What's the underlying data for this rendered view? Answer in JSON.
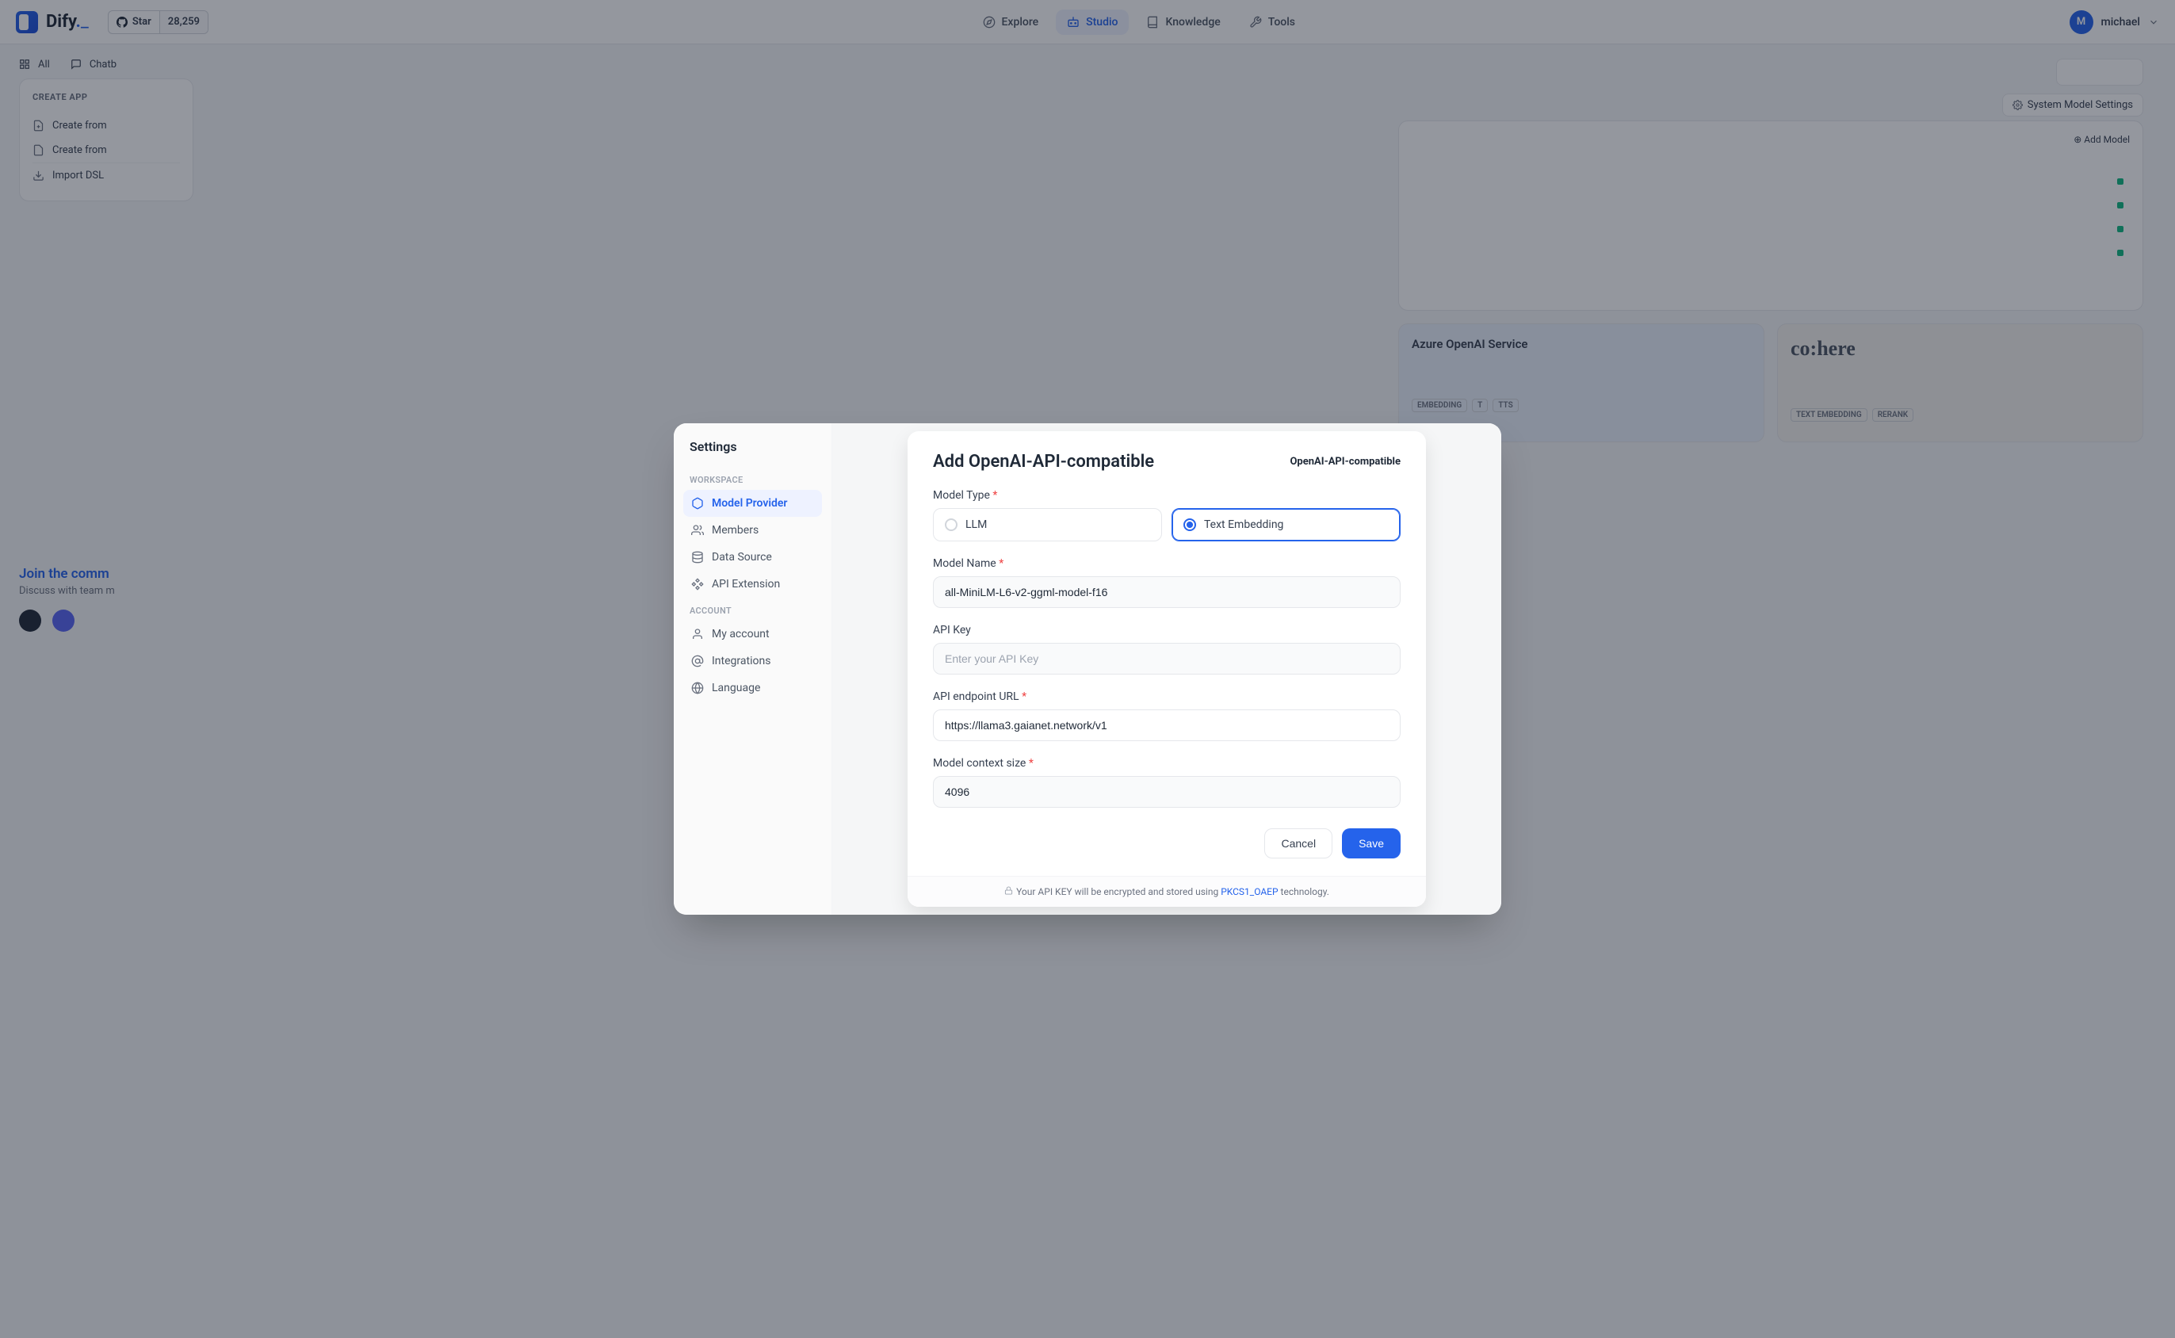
{
  "header": {
    "brand": "Dify",
    "star_label": "Star",
    "star_count": "28,259",
    "nav": {
      "explore": "Explore",
      "studio": "Studio",
      "knowledge": "Knowledge",
      "tools": "Tools"
    },
    "user": {
      "initial": "M",
      "name": "michael"
    }
  },
  "bg": {
    "tabs": {
      "all": "All",
      "chatbot": "Chatb"
    },
    "create": {
      "title": "CREATE APP",
      "blank": "Create from",
      "template": "Create from",
      "import": "Import DSL"
    },
    "sys_btn": "System Model Settings",
    "add_model": "Add Model",
    "azure_title": "Azure OpenAI Service",
    "cohere_logo": "co:here",
    "tags": {
      "embedding": "EMBEDDING",
      "t": "T",
      "tts": "TTS",
      "text_embedding": "TEXT EMBEDDING",
      "rerank": "RERANK"
    },
    "join": {
      "title": "Join the comm",
      "sub": "Discuss with team m"
    }
  },
  "settings": {
    "title": "Settings",
    "workspace_label": "WORKSPACE",
    "account_label": "ACCOUNT",
    "items": {
      "model_provider": "Model Provider",
      "members": "Members",
      "data_source": "Data Source",
      "api_extension": "API Extension",
      "my_account": "My account",
      "integrations": "Integrations",
      "language": "Language"
    }
  },
  "modal": {
    "title": "Add OpenAI-API-compatible",
    "provider": "OpenAI-API-compatible",
    "labels": {
      "model_type": "Model Type",
      "model_name": "Model Name",
      "api_key": "API Key",
      "api_endpoint": "API endpoint URL",
      "context_size": "Model context size"
    },
    "radio": {
      "llm": "LLM",
      "text_embed": "Text Embedding"
    },
    "values": {
      "model_name": "all-MiniLM-L6-v2-ggml-model-f16",
      "api_key_placeholder": "Enter your API Key",
      "api_endpoint": "https://llama3.gaianet.network/v1",
      "context_size": "4096"
    },
    "buttons": {
      "cancel": "Cancel",
      "save": "Save"
    },
    "encrypt": {
      "prefix": "Your API KEY will be encrypted and stored using ",
      "link": "PKCS1_OAEP",
      "suffix": " technology."
    }
  }
}
